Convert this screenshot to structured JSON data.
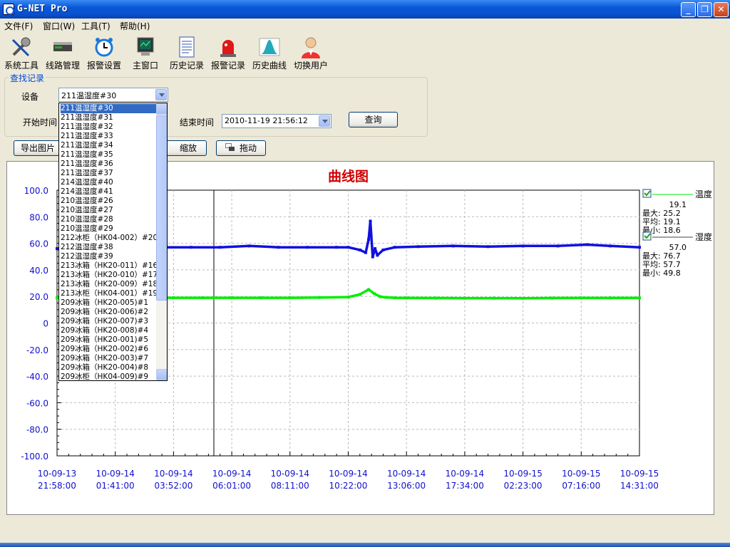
{
  "window": {
    "title": "G-NET Pro",
    "minimize": "_",
    "restore": "❐",
    "close": "✕"
  },
  "menu": [
    "文件(F)",
    "窗口(W)",
    "工具(T)",
    "帮助(H)"
  ],
  "toolbar": [
    {
      "label": "系统工具",
      "icon": "wrench-icon"
    },
    {
      "label": "线路管理",
      "icon": "device-icon"
    },
    {
      "label": "报警设置",
      "icon": "alarm-clock-icon"
    },
    {
      "label": "主窗口",
      "icon": "monitor-icon"
    },
    {
      "label": "历史记录",
      "icon": "document-icon"
    },
    {
      "label": "报警记录",
      "icon": "siren-icon"
    },
    {
      "label": "历史曲线",
      "icon": "curve-icon"
    },
    {
      "label": "切换用户",
      "icon": "user-icon"
    }
  ],
  "search": {
    "legend": "查找记录",
    "device_label": "设备",
    "device_value": "211温湿度#30",
    "start_label": "开始时间",
    "end_label": "结束时间",
    "end_value": "2010-11-19 21:56:12",
    "query_button": "查询"
  },
  "actions": {
    "export": "导出图片",
    "zoom": "缩放",
    "drag": "拖动"
  },
  "dropdown": {
    "selected_index": 0,
    "options": [
      "211温湿度#30",
      "211温湿度#31",
      "211温湿度#32",
      "211温湿度#33",
      "211温湿度#34",
      "211温湿度#35",
      "211温湿度#36",
      "211温湿度#37",
      "214温湿度#40",
      "214温湿度#41",
      "210温湿度#26",
      "210温湿度#27",
      "210温湿度#28",
      "210温湿度#29",
      "212冰柜（HK04-002）#20",
      "212温湿度#38",
      "212温湿度#39",
      "213冰箱（HK20-011）#16",
      "213冰箱（HK20-010）#17",
      "213冰箱（HK20-009）#18",
      "213冰柜（HK04-001）#19",
      "209冰箱（HK20-005)#1",
      "209冰箱（HK20-006)#2",
      "209冰箱（HK20-007)#3",
      "209冰箱（HK20-008)#4",
      "209冰箱（HK20-001)#5",
      "209冰箱（HK20-002)#6",
      "209冰箱（HK20-003)#7",
      "209冰箱（HK20-004)#8",
      "209冰柜（HK04-009)#9"
    ]
  },
  "chart_data": {
    "type": "line",
    "title": "曲线图",
    "ylim": [
      -100,
      100
    ],
    "yticks": [
      "100.0",
      "80.0",
      "60.0",
      "40.0",
      "20.0",
      "0",
      "-20.0",
      "-40.0",
      "-60.0",
      "-80.0",
      "-100.0"
    ],
    "xticks": [
      {
        "date": "10-09-13",
        "time": "21:58:00"
      },
      {
        "date": "10-09-14",
        "time": "01:41:00"
      },
      {
        "date": "10-09-14",
        "time": "03:52:00"
      },
      {
        "date": "10-09-14",
        "time": "06:01:00"
      },
      {
        "date": "10-09-14",
        "time": "08:11:00"
      },
      {
        "date": "10-09-14",
        "time": "10:22:00"
      },
      {
        "date": "10-09-14",
        "time": "13:06:00"
      },
      {
        "date": "10-09-14",
        "time": "17:34:00"
      },
      {
        "date": "10-09-15",
        "time": "02:23:00"
      },
      {
        "date": "10-09-15",
        "time": "07:16:00"
      },
      {
        "date": "10-09-15",
        "time": "14:31:00"
      }
    ],
    "grid": true,
    "legend_position": "right",
    "series": [
      {
        "name": "温度",
        "color": "#00ee00",
        "current": "19.1",
        "max_label": "最大: 25.2",
        "avg_label": "平均: 19.1",
        "min_label": "最小: 18.6",
        "x": [
          0,
          0.5,
          1,
          1.5,
          2,
          2.5,
          3,
          3.5,
          4,
          4.5,
          5,
          5.2,
          5.35,
          5.45,
          5.55,
          5.65,
          5.8,
          6,
          6.5,
          7,
          7.5,
          8,
          8.5,
          9,
          9.5,
          10
        ],
        "y": [
          19,
          19,
          19,
          19,
          19,
          19,
          19,
          19,
          19,
          19.2,
          19.5,
          21.5,
          25.2,
          22,
          19.8,
          19.3,
          19,
          18.9,
          18.8,
          18.7,
          18.7,
          18.6,
          18.8,
          18.9,
          18.9,
          18.9
        ]
      },
      {
        "name": "湿度",
        "color": "#1010e0",
        "current": "57.0",
        "max_label": "最大: 76.7",
        "avg_label": "平均: 57.7",
        "min_label": "最小: 49.8",
        "x": [
          0,
          0.3,
          0.8,
          1.3,
          1.8,
          2.3,
          2.8,
          3.3,
          3.8,
          4.3,
          4.8,
          5.0,
          5.2,
          5.3,
          5.35,
          5.38,
          5.42,
          5.46,
          5.5,
          5.6,
          5.8,
          6.2,
          6.8,
          7.4,
          8,
          8.6,
          9.1,
          9.5,
          10
        ],
        "y": [
          56,
          57,
          58,
          58,
          57,
          57,
          57,
          58,
          57,
          57,
          57,
          57,
          55,
          53,
          63,
          76.7,
          49.8,
          56,
          51,
          55,
          57,
          57.5,
          58,
          57.5,
          58,
          58,
          59,
          58,
          57
        ]
      }
    ]
  }
}
